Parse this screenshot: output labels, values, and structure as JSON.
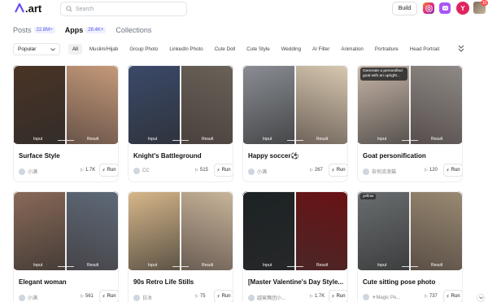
{
  "header": {
    "logo_text": ".art",
    "search_placeholder": "Search",
    "build_label": "Build",
    "avatar_letter": "Y",
    "notification_count": "10",
    "icons": [
      "instagram-icon",
      "discord-icon"
    ]
  },
  "tabs": [
    {
      "label": "Posts",
      "count": "22.8M+",
      "active": false
    },
    {
      "label": "Apps",
      "count": "28.4K+",
      "active": true
    },
    {
      "label": "Collections",
      "count": "",
      "active": false
    }
  ],
  "filters": {
    "sort_value": "Popular",
    "chips": [
      "All",
      "Muslim/Hijab",
      "Group Photo",
      "LinkedIn Photo",
      "Cute Doll",
      "Cute Style",
      "Wedding",
      "AI Filter",
      "Animation",
      "Portraiture",
      "Head Portrait"
    ],
    "active_chip": "All"
  },
  "labels": {
    "input": "Input",
    "result": "Result",
    "run": "Run"
  },
  "cards": [
    {
      "title": "Surface Style",
      "author": "小满",
      "uses": "1.7K",
      "colors": [
        "#4a3426",
        "#c69a7a"
      ],
      "overlay": ""
    },
    {
      "title": "Knight's Battleground",
      "author": "CC",
      "uses": "515",
      "colors": [
        "#3b4a6a",
        "#6a6258"
      ],
      "overlay": ""
    },
    {
      "title": "Happy soccer⚽",
      "author": "小满",
      "uses": "267",
      "colors": [
        "#8a8e94",
        "#d8c9b0"
      ],
      "overlay": ""
    },
    {
      "title": "Goat personification",
      "author": "奈何流浪猫",
      "uses": "120",
      "colors": [
        "#c8b6a8",
        "#8f8a86"
      ],
      "overlay": "Generate a personified goat with an upright..."
    },
    {
      "title": "Elegant woman",
      "author": "小满",
      "uses": "561",
      "colors": [
        "#8a6a58",
        "#5e6a78"
      ],
      "overlay": ""
    },
    {
      "title": "90s Retro Life Stills",
      "author": "日冰",
      "uses": "75",
      "colors": [
        "#d8b88a",
        "#c9b59a"
      ],
      "overlay": ""
    },
    {
      "title": "[Master Valentine's Day Style...",
      "author": "越竟舞团小...",
      "uses": "1.7K",
      "colors": [
        "#1c2224",
        "#6a1214"
      ],
      "overlay": ""
    },
    {
      "title": "Cute sitting pose photo",
      "author": "☀Magic Pe...",
      "uses": "737",
      "colors": [
        "#6a6e70",
        "#9a8a72"
      ],
      "overlay": "yellow"
    }
  ]
}
